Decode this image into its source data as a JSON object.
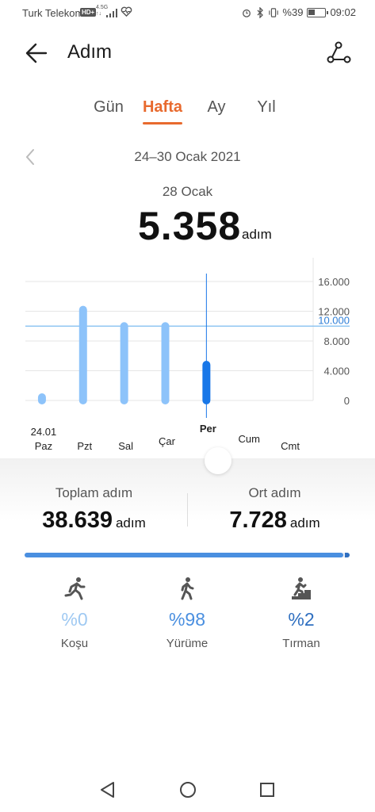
{
  "status_bar": {
    "carrier": "Turk Telekom",
    "hd": "HD+",
    "network_top": "4.5G",
    "network_bottom": "↑↓",
    "battery": "%39",
    "time": "09:02",
    "icons": [
      "signal-icon",
      "heart-icon",
      "alarm-icon",
      "bluetooth-icon",
      "vibrate-icon",
      "battery-icon"
    ]
  },
  "header": {
    "title": "Adım",
    "back_icon": "arrow-left-icon",
    "share_icon": "share-icon"
  },
  "tabs": [
    {
      "label": "Gün",
      "active": false
    },
    {
      "label": "Hafta",
      "active": true
    },
    {
      "label": "Ay",
      "active": false
    },
    {
      "label": "Yıl",
      "active": false
    }
  ],
  "range": {
    "label": "24–30 Ocak 2021",
    "selected_date": "28 Ocak",
    "selected_value": "5.358",
    "unit": "adım"
  },
  "chart_data": {
    "type": "bar",
    "categories": [
      "Paz",
      "Pzt",
      "Sal",
      "Çar",
      "Per",
      "Cum",
      "Cmt"
    ],
    "category_sublabels": [
      "24.01",
      "",
      "",
      "",
      "",
      "",
      ""
    ],
    "values": [
      250,
      12200,
      10000,
      10000,
      4800,
      0,
      0
    ],
    "selected_index": 4,
    "y_ticks": [
      "16.000",
      "12.000",
      "8.000",
      "4.000",
      "0"
    ],
    "y_tick_values": [
      16000,
      12000,
      8000,
      4000,
      0
    ],
    "ylim": [
      0,
      16000
    ],
    "goal_line": {
      "value": 10000,
      "label": "10.000"
    },
    "colors": {
      "bar": "#8dc3fa",
      "selected_bar": "#1877e8",
      "goal": "#7cbcf0",
      "grid": "#e6e6e6"
    },
    "title": "",
    "xlabel": "",
    "ylabel": ""
  },
  "stats": {
    "total_label": "Toplam adım",
    "total_value": "38.639",
    "avg_label": "Ort adım",
    "avg_value": "7.728",
    "unit": "adım"
  },
  "breakdown": {
    "progress": {
      "walk_fraction": 0.98,
      "climb_fraction": 0.02
    },
    "items": [
      {
        "name": "Koşu",
        "pct": "%0",
        "icon": "running-icon",
        "color": "#9fc9f2"
      },
      {
        "name": "Yürüme",
        "pct": "%98",
        "icon": "walking-icon",
        "color": "#4a8fe0"
      },
      {
        "name": "Tırman",
        "pct": "%2",
        "icon": "climbing-icon",
        "color": "#2f6fc0"
      }
    ]
  },
  "nav": {
    "icons": [
      "nav-back-icon",
      "nav-home-icon",
      "nav-recents-icon"
    ]
  }
}
